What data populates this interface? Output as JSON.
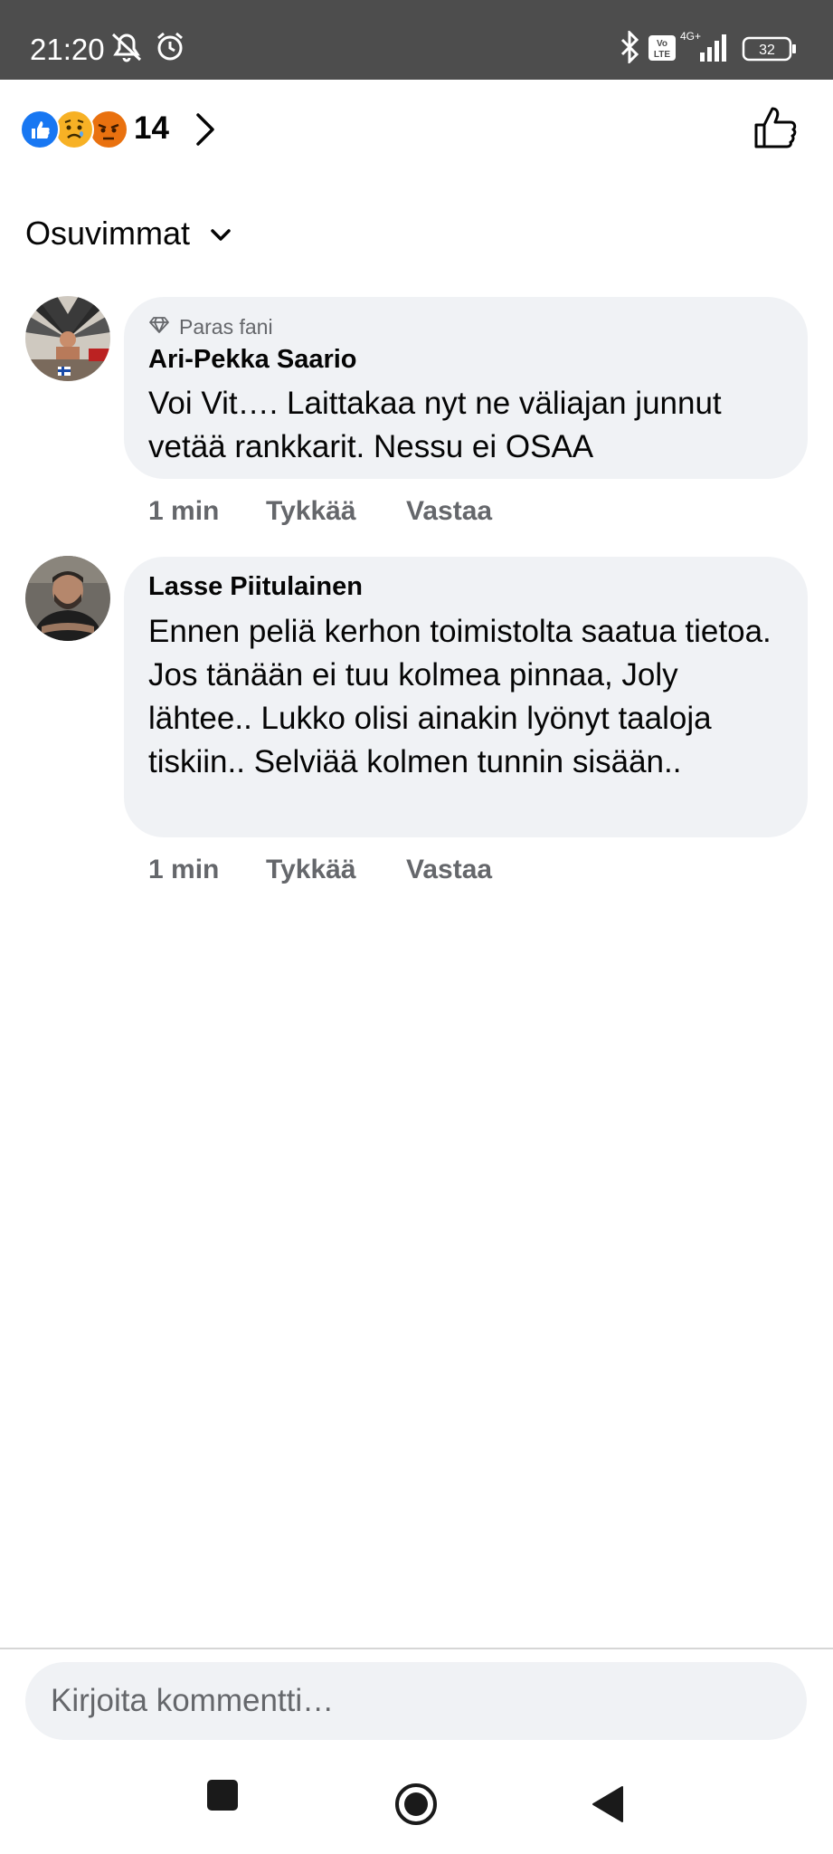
{
  "status_bar": {
    "time": "21:20",
    "icons": [
      "muted-bell-icon",
      "alarm-icon",
      "bluetooth-icon",
      "volte-icon",
      "signal-icon",
      "battery-icon"
    ],
    "network": "4G+",
    "volte": "Vo LTE",
    "battery": "32"
  },
  "reactions": {
    "types": [
      "like",
      "sad",
      "angry"
    ],
    "count": "14",
    "colors": {
      "like": "#1877f2",
      "sad": "#f7b125",
      "angry": "#e9710f"
    }
  },
  "sort": {
    "label": "Osuvimmat"
  },
  "comments": [
    {
      "badge": "Paras fani",
      "author": "Ari-Pekka Saario",
      "text": "Voi Vit…. Laittakaa nyt ne väliajan junnut vetää rankkarit. Nessu ei OSAA",
      "time": "1 min",
      "like": "Tykkää",
      "reply": "Vastaa"
    },
    {
      "author": "Lasse Piitulainen",
      "text": "Ennen peliä kerhon toimistolta saatua tietoa. Jos tänään ei tuu kolmea pinnaa, Joly lähtee.. Lukko olisi ainakin lyönyt taaloja tiskiin.. Selviää kolmen tunnin sisään..",
      "time": "1 min",
      "like": "Tykkää",
      "reply": "Vastaa"
    }
  ],
  "composer": {
    "placeholder": "Kirjoita kommentti…"
  },
  "nav": [
    "recents-button",
    "home-button",
    "back-button"
  ]
}
